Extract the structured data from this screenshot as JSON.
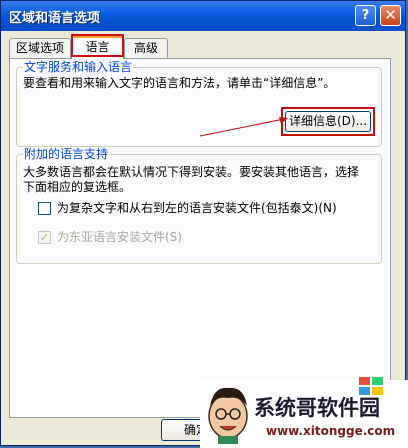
{
  "window": {
    "title": "区域和语言选项",
    "help_label": "?",
    "close_label": "✕"
  },
  "tabs": [
    {
      "label": "区域选项"
    },
    {
      "label": "语言"
    },
    {
      "label": "高级"
    }
  ],
  "text_services": {
    "legend": "文字服务和输入语言",
    "description": "要查看和用来输入文字的语言和方法，请单击“详细信息”。",
    "details_button": "详细信息(D)..."
  },
  "supplemental": {
    "legend": "附加的语言支持",
    "description_line1": "大多数语言都会在默认情况下得到安装。要安装其他语言，选择",
    "description_line2": "下面相应的复选框。",
    "complex_script_label": "为复杂文字和从右到左的语言安装文件(包括泰文)(N)",
    "east_asian_label": "为东亚语言安装文件(S)",
    "east_asian_checked": true,
    "complex_script_checked": false
  },
  "footer": {
    "ok_label": "确定"
  },
  "watermark": {
    "text": "系统哥软件园",
    "url": "www.xitongge.com"
  },
  "colors": {
    "annotation_red": "#c01010",
    "legend_blue": "#0046d5",
    "titlebar_blue": "#0a5fe0"
  }
}
